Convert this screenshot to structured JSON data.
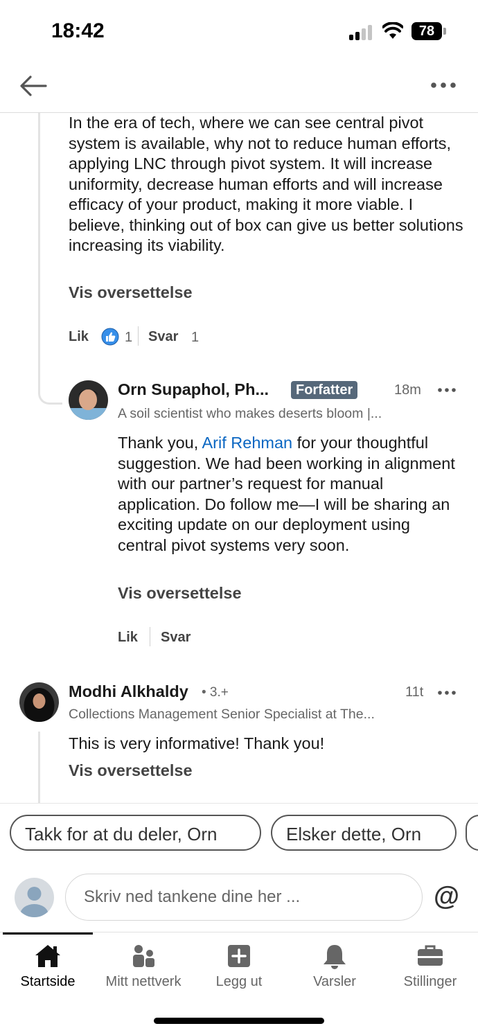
{
  "status_bar": {
    "time": "18:42",
    "battery": "78"
  },
  "comments": [
    {
      "text": "In the era of tech, where we can see central pivot system is available, why not to reduce human efforts, applying LNC through pivot system. It will increase uniformity, decrease human efforts and will increase efficacy of your product, making it more viable. I believe, thinking out of box can give us better solutions increasing its viability.",
      "translate": "Vis oversettelse",
      "like_label": "Lik",
      "like_count": "1",
      "reply_label": "Svar",
      "reply_count": "1"
    },
    {
      "author": "Orn Supaphol, Ph...",
      "badge": "Forfatter",
      "time": "18m",
      "headline": "A soil scientist who makes deserts bloom |...",
      "text_before": "Thank you,",
      "mention": "Arif Rehman",
      "text_after": " for your thoughtful suggestion. We had been working in alignment with our partner’s request for manual application. Do follow me—I will be sharing an exciting update on our deployment using central pivot systems very soon.",
      "translate": "Vis oversettelse",
      "like_label": "Lik",
      "reply_label": "Svar"
    },
    {
      "author": "Modhi Alkhaldy",
      "degree": "• 3.+",
      "time": "11t",
      "headline": "Collections Management Senior Specialist at The...",
      "text": "This is very informative! Thank you!",
      "translate": "Vis oversettelse"
    }
  ],
  "suggestions": [
    "Takk for at du deler, Orn",
    "Elsker dette, Orn"
  ],
  "compose": {
    "placeholder": "Skriv ned tankene dine her ...",
    "at_symbol": "@"
  },
  "nav": [
    {
      "label": "Startside",
      "icon": "home-icon",
      "active": true
    },
    {
      "label": "Mitt nettverk",
      "icon": "network-icon"
    },
    {
      "label": "Legg ut",
      "icon": "post-icon"
    },
    {
      "label": "Varsler",
      "icon": "bell-icon"
    },
    {
      "label": "Stillinger",
      "icon": "briefcase-icon"
    }
  ],
  "colors": {
    "link": "#0a66c2",
    "badge": "#56687a",
    "like": "#378fe9"
  }
}
